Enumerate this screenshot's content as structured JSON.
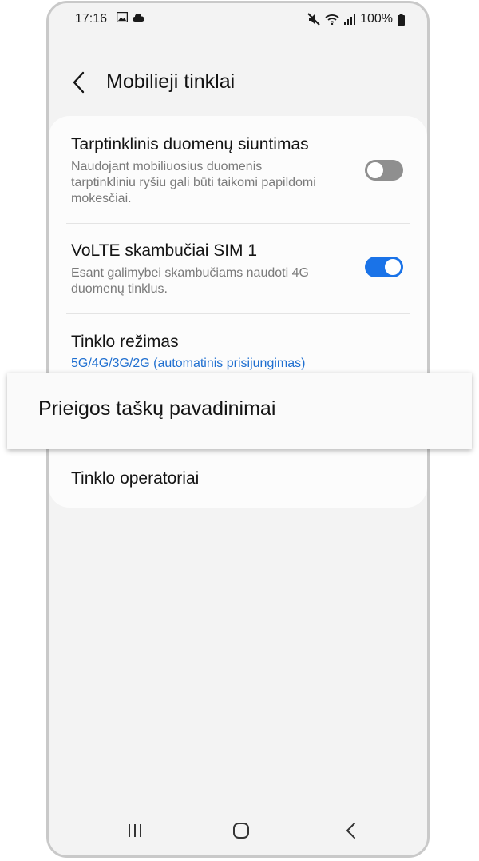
{
  "status_bar": {
    "time": "17:16",
    "battery": "100%"
  },
  "header": {
    "title": "Mobilieji tinklai"
  },
  "settings": {
    "roaming": {
      "title": "Tarptinklinis duomenų siuntimas",
      "description": "Naudojant mobiliuosius duomenis tarptinkliniu ryšiu gali būti taikomi papildomi mokesčiai.",
      "enabled": false
    },
    "volte": {
      "title": "VoLTE skambučiai SIM 1",
      "description": "Esant galimybei skambučiams naudoti 4G duomenų tinklus.",
      "enabled": true
    },
    "network_mode": {
      "title": "Tinklo režimas",
      "value": "5G/4G/3G/2G (automatinis prisijungimas)"
    },
    "apn": {
      "title": "Prieigos taškų pavadinimai"
    },
    "operators": {
      "title": "Tinklo operatoriai"
    }
  },
  "colors": {
    "accent": "#1a73e8",
    "toggle_off": "#8f8f8f",
    "background": "#f3f3f3",
    "card": "#fcfcfc"
  },
  "icons": {
    "status_left": [
      "image-icon",
      "cloud-icon"
    ],
    "status_right": [
      "mute-icon",
      "wifi-icon",
      "signal-icon",
      "battery-icon"
    ],
    "nav": [
      "recent-apps-icon",
      "home-icon",
      "back-icon"
    ]
  }
}
